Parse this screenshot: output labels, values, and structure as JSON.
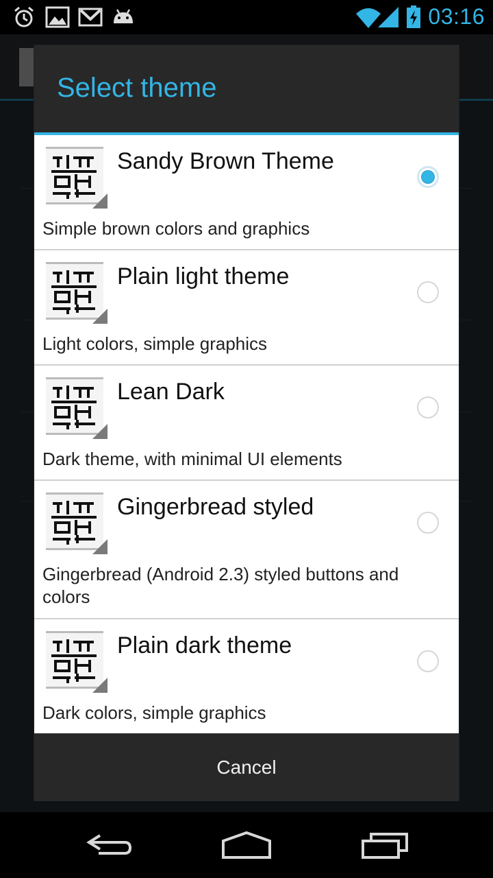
{
  "status_bar": {
    "time": "03:16",
    "left_icons": [
      "alarm-icon",
      "image-icon",
      "gmail-icon",
      "android-icon"
    ],
    "right_icons": [
      "wifi-icon",
      "signal-icon",
      "battery-charging-icon"
    ],
    "accent": "#33b5e5"
  },
  "dialog": {
    "title": "Select theme",
    "accent": "#33b5e5",
    "items": [
      {
        "title": "Sandy Brown Theme",
        "description": "Simple brown colors and graphics",
        "checked": true
      },
      {
        "title": "Plain light theme",
        "description": "Light colors, simple graphics",
        "checked": false
      },
      {
        "title": "Lean Dark",
        "description": "Dark theme, with minimal UI elements",
        "checked": false
      },
      {
        "title": "Gingerbread styled",
        "description": "Gingerbread (Android 2.3) styled buttons and colors",
        "checked": false
      },
      {
        "title": "Plain dark theme",
        "description": "Dark colors, simple graphics",
        "checked": false
      }
    ],
    "cancel_label": "Cancel"
  },
  "nav_bar": {
    "buttons": [
      "back-icon",
      "home-icon",
      "recent-apps-icon"
    ]
  }
}
